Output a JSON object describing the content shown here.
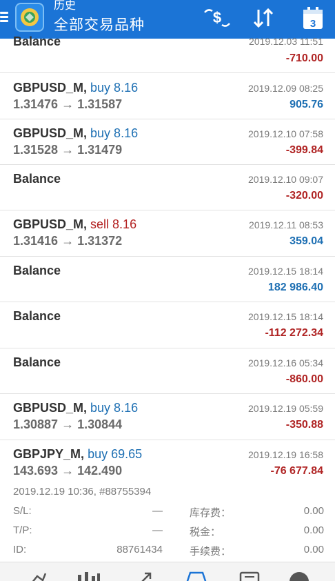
{
  "header": {
    "title_small": "历史",
    "title_main": "全部交易品种",
    "calendar_day": "3",
    "icons": [
      "menu-icon",
      "app-logo-icon",
      "currency-swap-icon",
      "sort-icon",
      "calendar-icon"
    ]
  },
  "rows": [
    {
      "symbol": "Balance",
      "date": "2019.12.03 11:51",
      "amount": "-710.00"
    },
    {
      "symbol": "GBPUSD_M,",
      "direction": "buy 8.16",
      "prices": "1.31476 → 1.31587",
      "date": "2019.12.09 08:25",
      "amount": "905.76"
    },
    {
      "symbol": "GBPUSD_M,",
      "direction": "buy 8.16",
      "prices": "1.31528 → 1.31479",
      "date": "2019.12.10 07:58",
      "amount": "-399.84"
    },
    {
      "symbol": "Balance",
      "date": "2019.12.10 09:07",
      "amount": "-320.00"
    },
    {
      "symbol": "GBPUSD_M,",
      "direction": "sell 8.16",
      "prices": "1.31416 → 1.31372",
      "date": "2019.12.11 08:53",
      "amount": "359.04"
    },
    {
      "symbol": "Balance",
      "date": "2019.12.15 18:14",
      "amount": "182 986.40"
    },
    {
      "symbol": "Balance",
      "date": "2019.12.15 18:14",
      "amount": "-112 272.34"
    },
    {
      "symbol": "Balance",
      "date": "2019.12.16 05:34",
      "amount": "-860.00"
    },
    {
      "symbol": "GBPUSD_M,",
      "direction": "buy 8.16",
      "prices": "1.30887 → 1.30844",
      "date": "2019.12.19 05:59",
      "amount": "-350.88"
    },
    {
      "symbol": "GBPJPY_M,",
      "direction": "buy 69.65",
      "prices": "143.693 → 142.490",
      "date": "2019.12.19 16:58",
      "amount": "-76 677.84"
    }
  ],
  "details": {
    "open_info": "2019.12.19 10:36, #88755394",
    "sl_label": "S/L:",
    "sl_value": "—",
    "tp_label": "T/P:",
    "tp_value": "—",
    "id_label": "ID:",
    "id_value": "88761434",
    "swap_label": "库存费：",
    "swap_value": "0.00",
    "tax_label": "税金：",
    "tax_value": "0.00",
    "fee_label": "手续费：",
    "fee_value": "0.00"
  },
  "bottom_nav": [
    "quotes-icon",
    "chart-icon",
    "trade-icon",
    "history-icon",
    "messages-icon",
    "settings-icon"
  ],
  "colors": {
    "header": "#1b74d6",
    "negative": "#b02424",
    "positive": "#1d6fb3"
  }
}
